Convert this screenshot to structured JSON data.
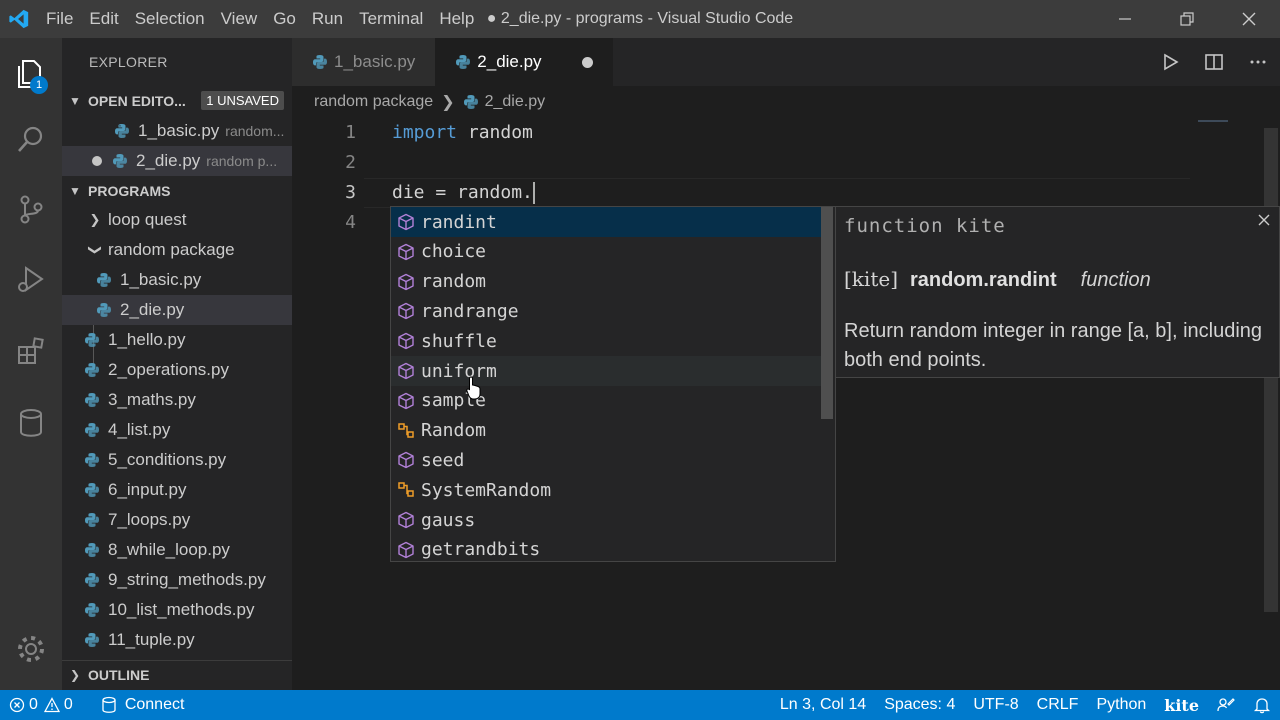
{
  "window": {
    "title": "● 2_die.py - programs - Visual Studio Code",
    "menu": [
      "File",
      "Edit",
      "Selection",
      "View",
      "Go",
      "Run",
      "Terminal",
      "Help"
    ]
  },
  "activity_bar": {
    "explorer_badge": "1",
    "icons": [
      "files-icon",
      "search-icon",
      "source-control-icon",
      "run-debug-icon",
      "extensions-icon",
      "database-icon",
      "settings-gear-icon"
    ]
  },
  "sidebar": {
    "title": "EXPLORER",
    "open_editors": {
      "label": "OPEN EDITO...",
      "badge": "1 UNSAVED",
      "items": [
        {
          "name": "1_basic.py",
          "desc": "random..."
        },
        {
          "name": "2_die.py",
          "desc": "random p..."
        }
      ]
    },
    "workspace": {
      "label": "PROGRAMS",
      "folders": [
        {
          "name": "loop quest",
          "expanded": false
        },
        {
          "name": "random package",
          "expanded": true
        }
      ],
      "folder_files": [
        "1_basic.py",
        "2_die.py"
      ],
      "files": [
        "1_hello.py",
        "2_operations.py",
        "3_maths.py",
        "4_list.py",
        "5_conditions.py",
        "6_input.py",
        "7_loops.py",
        "8_while_loop.py",
        "9_string_methods.py",
        "10_list_methods.py",
        "11_tuple.py"
      ]
    },
    "outline_label": "OUTLINE"
  },
  "tabs": [
    {
      "label": "1_basic.py",
      "active": false
    },
    {
      "label": "2_die.py",
      "active": true,
      "modified": true
    }
  ],
  "breadcrumb": {
    "folder": "random package",
    "file": "2_die.py"
  },
  "editor": {
    "line_numbers": [
      "1",
      "2",
      "3",
      "4"
    ],
    "lines": {
      "l1_kw": "import",
      "l1_rest": " random",
      "l3": "die = random."
    }
  },
  "suggestions": {
    "items": [
      {
        "label": "randint",
        "kind": "method"
      },
      {
        "label": "choice",
        "kind": "method"
      },
      {
        "label": "random",
        "kind": "method"
      },
      {
        "label": "randrange",
        "kind": "method"
      },
      {
        "label": "shuffle",
        "kind": "method"
      },
      {
        "label": "uniform",
        "kind": "method"
      },
      {
        "label": "sample",
        "kind": "method"
      },
      {
        "label": "Random",
        "kind": "class"
      },
      {
        "label": "seed",
        "kind": "method"
      },
      {
        "label": "SystemRandom",
        "kind": "class"
      },
      {
        "label": "gauss",
        "kind": "method"
      },
      {
        "label": "getrandbits",
        "kind": "method"
      }
    ],
    "method_color": "#b180d7",
    "class_color": "#ee9d28"
  },
  "details": {
    "header": "function kite",
    "kite_tag": "[kite]",
    "name": "random.randint",
    "kind": "function",
    "doc": "Return random integer in range [a, b], including both end points."
  },
  "status": {
    "errors": "0",
    "warnings": "0",
    "connect": "Connect",
    "position": "Ln 3, Col 14",
    "spaces": "Spaces: 4",
    "encoding": "UTF-8",
    "eol": "CRLF",
    "language": "Python",
    "kite": "kite"
  },
  "colors": {
    "accent": "#007acc",
    "keyword": "#569cd6",
    "python_icon": "#519aba"
  }
}
